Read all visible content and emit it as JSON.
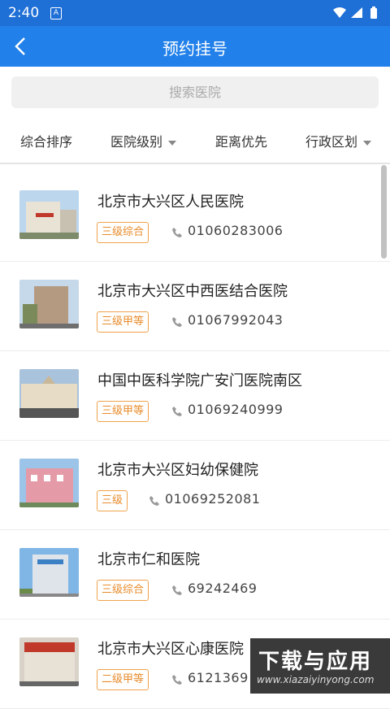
{
  "status_bar": {
    "time": "2:40",
    "notification_icon": "A"
  },
  "app_bar": {
    "title": "预约挂号"
  },
  "search": {
    "placeholder": "搜索医院"
  },
  "filters": [
    {
      "label": "综合排序",
      "has_dropdown": false
    },
    {
      "label": "医院级别",
      "has_dropdown": true
    },
    {
      "label": "距离优先",
      "has_dropdown": false
    },
    {
      "label": "行政区划",
      "has_dropdown": true
    }
  ],
  "hospitals": [
    {
      "name": "北京市大兴区人民医院",
      "level": "三级综合",
      "phone": "01060283006"
    },
    {
      "name": "北京市大兴区中西医结合医院",
      "level": "三级甲等",
      "phone": "01067992043"
    },
    {
      "name": "中国中医科学院广安门医院南区",
      "level": "三级甲等",
      "phone": "01069240999"
    },
    {
      "name": "北京市大兴区妇幼保健院",
      "level": "三级",
      "phone": "01069252081"
    },
    {
      "name": "北京市仁和医院",
      "level": "三级综合",
      "phone": "69242469"
    },
    {
      "name": "北京市大兴区心康医院",
      "level": "二级甲等",
      "phone": "6121369"
    }
  ],
  "watermark": {
    "title": "下载与应用",
    "url": "www.xiazaiyinyong.com"
  },
  "colors": {
    "primary": "#2180e9",
    "badge": "#e88b2a"
  }
}
